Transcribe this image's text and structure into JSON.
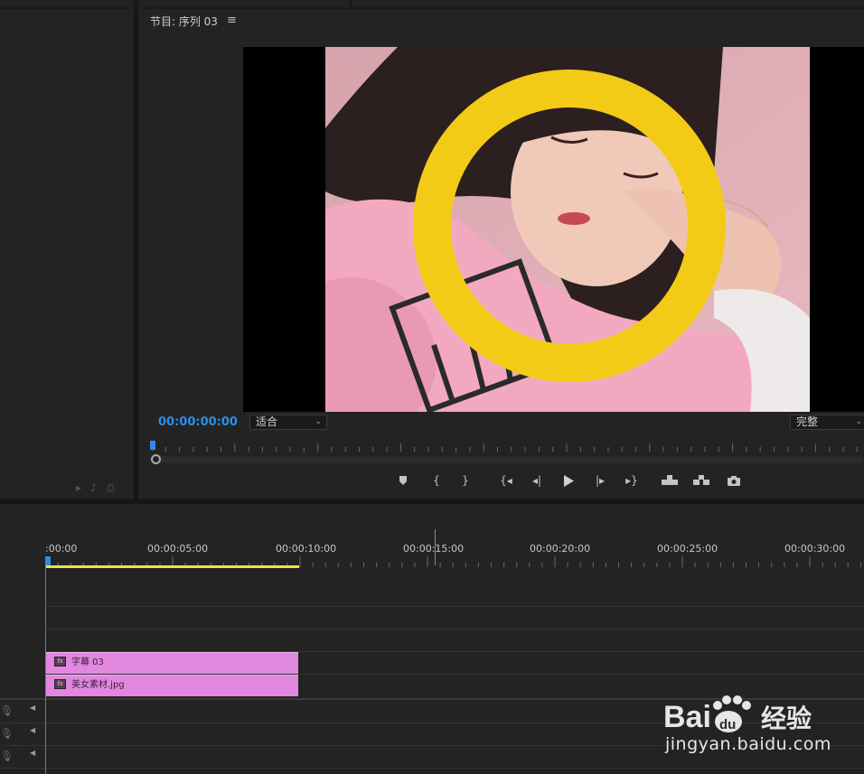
{
  "monitor": {
    "title": "节目: 序列 03",
    "menu_icon": "hamburger-icon",
    "timecode": "00:00:00:00",
    "fit_select": "适合",
    "quality_select": "完整"
  },
  "transport_controls": [
    {
      "name": "add-marker-button",
      "icon": "marker-icon"
    },
    {
      "name": "mark-in-button",
      "icon": "mark-in-icon"
    },
    {
      "name": "mark-out-button",
      "icon": "mark-out-icon"
    },
    {
      "name": "go-to-in-button",
      "icon": "go-to-in-icon"
    },
    {
      "name": "step-back-button",
      "icon": "step-back-icon"
    },
    {
      "name": "play-button",
      "icon": "play-icon"
    },
    {
      "name": "step-forward-button",
      "icon": "step-forward-icon"
    },
    {
      "name": "go-to-out-button",
      "icon": "go-to-out-icon"
    },
    {
      "name": "lift-button",
      "icon": "lift-icon"
    },
    {
      "name": "extract-button",
      "icon": "extract-icon"
    },
    {
      "name": "export-frame-button",
      "icon": "camera-icon"
    }
  ],
  "timeline": {
    "ruler_labels": [
      ":00:00",
      "00:00:05:00",
      "00:00:10:00",
      "00:00:15:00",
      "00:00:20:00",
      "00:00:25:00",
      "00:00:30:00"
    ],
    "clips": [
      {
        "label": "字幕 03",
        "badge": "fx"
      },
      {
        "label": "美女素材.jpg",
        "badge": "fx"
      }
    ]
  },
  "watermark": {
    "brand": "Bai",
    "brand_du": "du",
    "brand_cn": "经验",
    "url": "jingyan.baidu.com"
  },
  "colors": {
    "accent_blue": "#2d8ceb",
    "clip_pink": "#e287e0",
    "work_area_yellow": "#e9e34a",
    "ring_yellow": "#f3cb16"
  }
}
